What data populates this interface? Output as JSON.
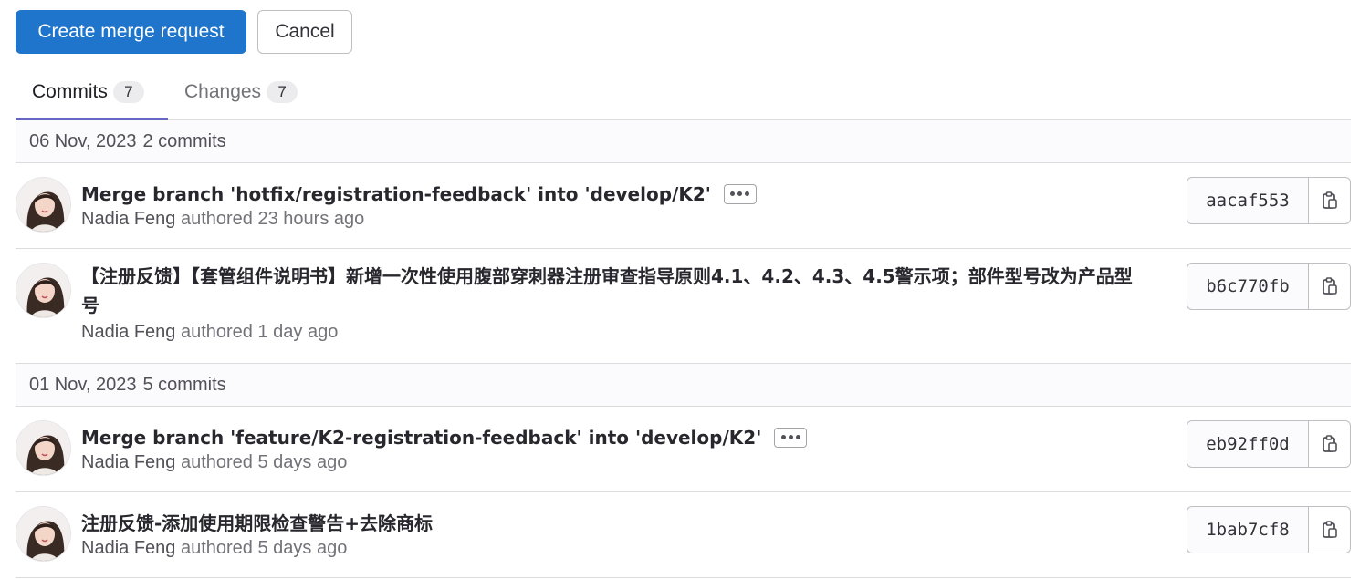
{
  "actions": {
    "create_label": "Create merge request",
    "cancel_label": "Cancel"
  },
  "tabs": [
    {
      "label": "Commits",
      "count": "7",
      "active": true
    },
    {
      "label": "Changes",
      "count": "7",
      "active": false
    }
  ],
  "days": [
    {
      "date": "06 Nov, 2023",
      "count": "2 commits"
    },
    {
      "date": "01 Nov, 2023",
      "count": "5 commits"
    }
  ],
  "commits": [
    {
      "title": "Merge branch 'hotfix/registration-feedback' into 'develop/K2'",
      "has_ellipsis": true,
      "author": "Nadia Feng",
      "authored": "authored 23 hours ago",
      "sha": "aacaf553"
    },
    {
      "title": "【注册反馈】【套管组件说明书】新增一次性使用腹部穿刺器注册审查指导原则4.1、4.2、4.3、4.5警示项；部件型号改为产品型号",
      "has_ellipsis": false,
      "author": "Nadia Feng",
      "authored": "authored 1 day ago",
      "sha": "b6c770fb"
    },
    {
      "title": "Merge branch 'feature/K2-registration-feedback' into 'develop/K2'",
      "has_ellipsis": true,
      "author": "Nadia Feng",
      "authored": "authored 5 days ago",
      "sha": "eb92ff0d"
    },
    {
      "title": "注册反馈-添加使用期限检查警告+去除商标",
      "has_ellipsis": false,
      "author": "Nadia Feng",
      "authored": "authored 5 days ago",
      "sha": "1bab7cf8"
    }
  ],
  "colors": {
    "primary": "#1f75cb",
    "tab_active_underline": "#6666c4",
    "day_header_bg": "#fbfafd"
  },
  "icons": {
    "avatar": "avatar-photo",
    "copy": "clipboard-icon",
    "ellipsis": "ellipsis-icon"
  }
}
